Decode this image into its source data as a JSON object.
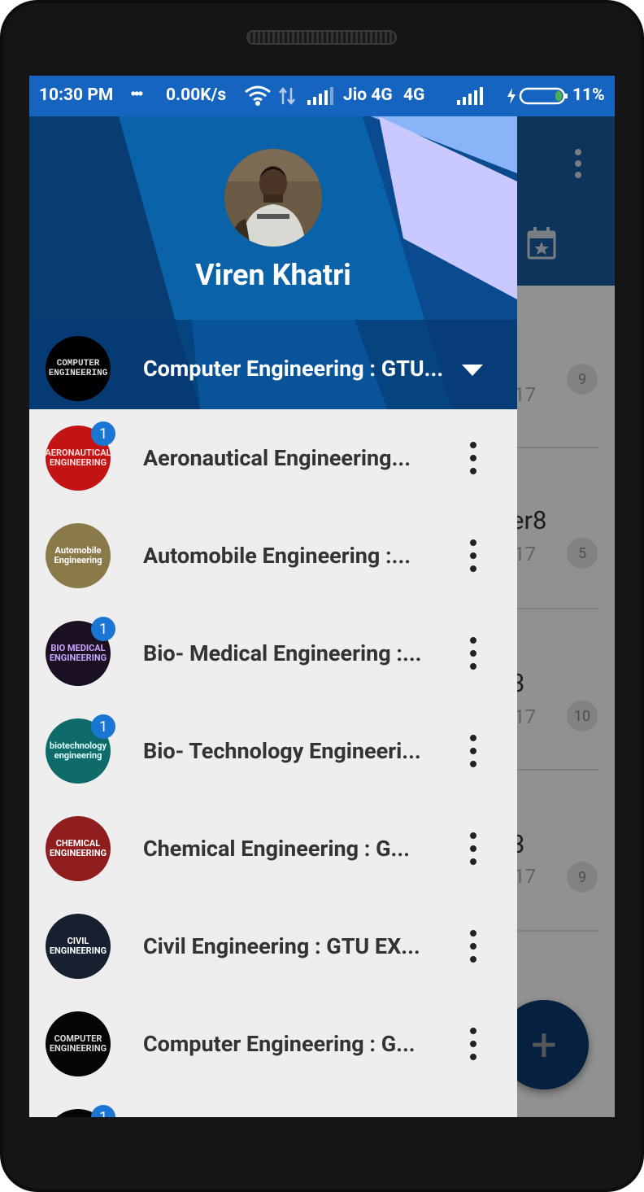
{
  "status_bar": {
    "time": "10:30 PM",
    "dots": "•••",
    "speed": "0.00K/s",
    "carrier": "Jio 4G",
    "network_type": "4G",
    "battery": "11%"
  },
  "drawer": {
    "user_name": "Viren Khatri",
    "current_account": "Computer Engineering : GTU...",
    "current_account_logo": "COMPUTER ENGINEERING",
    "items": [
      {
        "label": "Aeronautical Engineering...",
        "logo": "AERONAUTICAL ENGINEERING",
        "badge": "1",
        "logo_bg": "#c21414",
        "logo_color": "#ffd9d9"
      },
      {
        "label": "Automobile Engineering :...",
        "logo": "Automobile Engineering",
        "badge": "",
        "logo_bg": "#8a7a4a",
        "logo_color": "#ffffff"
      },
      {
        "label": "Bio- Medical Engineering :...",
        "logo": "BIO MEDICAL ENGINEERING",
        "badge": "1",
        "logo_bg": "#1a1022",
        "logo_color": "#c9a6ff"
      },
      {
        "label": "Bio- Technology Engineeri...",
        "logo": "biotechnology engineering",
        "badge": "1",
        "logo_bg": "#0f6a6a",
        "logo_color": "#e0ffff"
      },
      {
        "label": "Chemical Engineering : G...",
        "logo": "CHEMICAL ENGINEERING",
        "badge": "",
        "logo_bg": "#8f1d1d",
        "logo_color": "#ffffff"
      },
      {
        "label": "Civil Engineering : GTU EX...",
        "logo": "CIVIL ENGINEERING",
        "badge": "",
        "logo_bg": "#17202e",
        "logo_color": "#ffffff"
      },
      {
        "label": "Computer Engineering : G...",
        "logo": "COMPUTER ENGINEERING",
        "badge": "",
        "logo_bg": "#050505",
        "logo_color": "#dddddd"
      },
      {
        "label": "",
        "logo": "",
        "badge": "1",
        "logo_bg": "#050505",
        "logo_color": "#dddddd"
      }
    ]
  },
  "background": {
    "rows": [
      {
        "title": "",
        "sub": "17",
        "count": "9"
      },
      {
        "title": "er8",
        "sub": "17",
        "count": "5"
      },
      {
        "title": "3",
        "sub": "17",
        "count": "10"
      },
      {
        "title": "3",
        "sub": "17",
        "count": "9"
      }
    ],
    "fab_label": "+"
  },
  "colors": {
    "status_bar": "#1565c0",
    "badge": "#1976d2",
    "drawer_bg": "#eeeeee"
  },
  "icons": {
    "wifi": "wifi-icon",
    "data": "data-arrows-icon",
    "signal": "signal-icon",
    "battery": "battery-icon",
    "calendar": "calendar-icon",
    "overflow": "overflow-menu-icon"
  }
}
